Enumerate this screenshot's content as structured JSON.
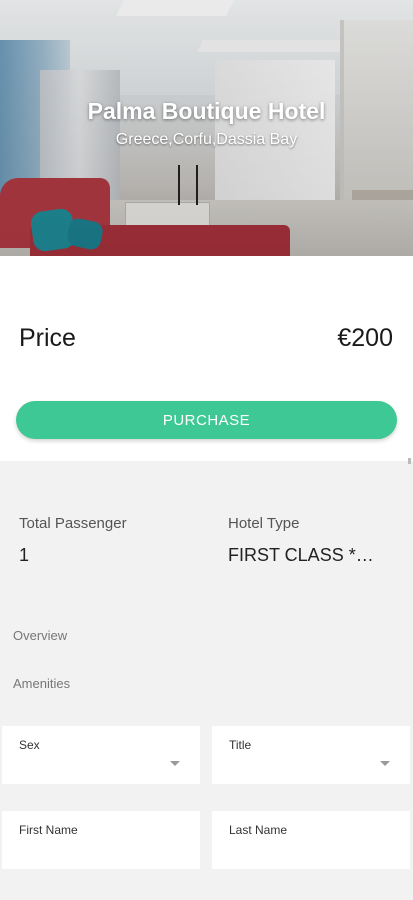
{
  "hotel": {
    "name": "Palma Boutique Hotel",
    "location": "Greece,Corfu,Dassia Bay"
  },
  "pricing": {
    "label": "Price",
    "value": "€200"
  },
  "actions": {
    "purchase_label": "PURCHASE"
  },
  "details": {
    "passenger_label": "Total Passenger",
    "passenger_value": "1",
    "hotel_type_label": "Hotel Type",
    "hotel_type_value": "FIRST CLASS *…"
  },
  "sections": {
    "overview": "Overview",
    "amenities": "Amenities"
  },
  "form": {
    "sex_label": "Sex",
    "title_label": "Title",
    "first_name_label": "First Name",
    "last_name_label": "Last Name"
  },
  "colors": {
    "accent": "#3ec896",
    "background": "#f2f2f2"
  }
}
